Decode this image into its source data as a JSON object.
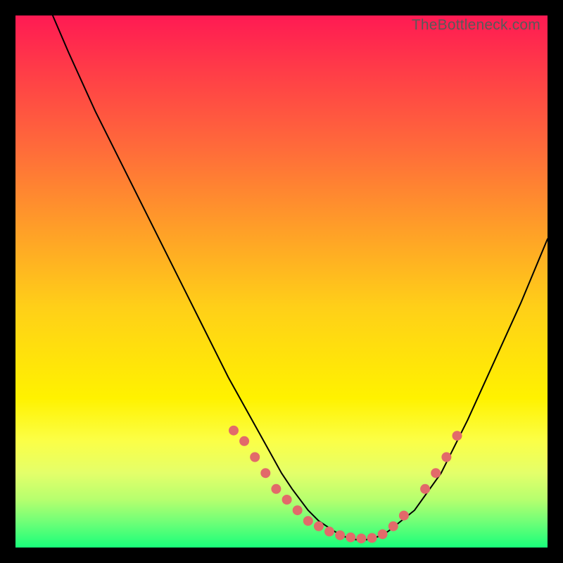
{
  "watermark": "TheBottleneck.com",
  "colors": {
    "background": "#000000",
    "gradient_top": "#ff1a53",
    "gradient_bottom": "#19ff7a",
    "curve": "#000000",
    "dots": "#e26a6a"
  },
  "chart_data": {
    "type": "line",
    "title": "",
    "xlabel": "",
    "ylabel": "",
    "xlim": [
      0,
      100
    ],
    "ylim": [
      0,
      100
    ],
    "annotations": [
      "TheBottleneck.com"
    ],
    "series": [
      {
        "name": "bottleneck-curve",
        "x": [
          7,
          10,
          15,
          20,
          25,
          30,
          35,
          40,
          45,
          50,
          52,
          55,
          57,
          60,
          62,
          64,
          66,
          68,
          70,
          75,
          80,
          85,
          90,
          95,
          100
        ],
        "y": [
          100,
          93,
          82,
          72,
          62,
          52,
          42,
          32,
          23,
          14,
          11,
          7,
          5,
          3,
          2,
          1.5,
          1.5,
          2,
          3,
          7,
          14,
          24,
          35,
          46,
          58
        ]
      }
    ],
    "highlight_points": {
      "name": "fit-region",
      "x": [
        41,
        43,
        45,
        47,
        49,
        51,
        53,
        55,
        57,
        59,
        61,
        63,
        65,
        67,
        69,
        71,
        73,
        77,
        79,
        81,
        83
      ],
      "y": [
        22,
        20,
        17,
        14,
        11,
        9,
        7,
        5,
        4,
        3,
        2.3,
        1.9,
        1.7,
        1.8,
        2.5,
        4,
        6,
        11,
        14,
        17,
        21
      ]
    }
  }
}
